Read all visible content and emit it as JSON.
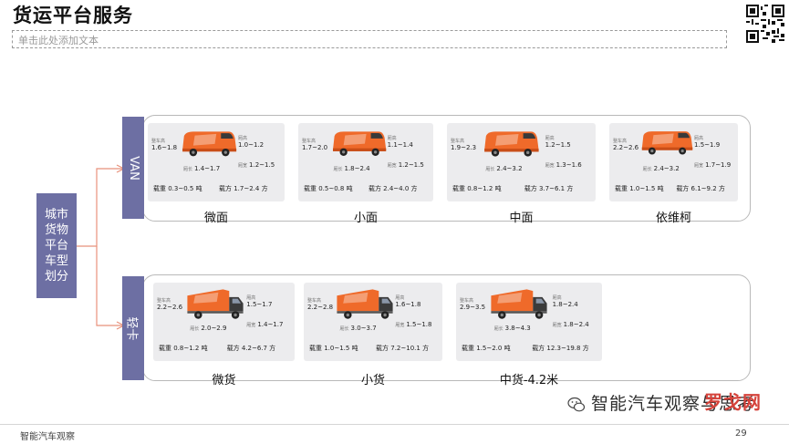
{
  "header": {
    "title": "货运平台服务",
    "subtitle_placeholder": "单击此处添加文本"
  },
  "diagram": {
    "root_label": "城市\n货物\n平台\n车型\n划分",
    "groups": [
      {
        "label": "VAN",
        "cards": [
          {
            "name": "微面",
            "height_label": "整车高",
            "height": "1.6~1.8",
            "width_label": "厢高",
            "width": "1.0~1.2",
            "length_label": "厢长",
            "length": "1.4~1.7",
            "box_width_label": "厢宽",
            "box_width": "1.2~1.5",
            "load": "载重 0.3~0.5 吨",
            "volume": "载方 1.7~2.4 方"
          },
          {
            "name": "小面",
            "height_label": "整车高",
            "height": "1.7~2.0",
            "width_label": "厢高",
            "width": "1.1~1.4",
            "length_label": "厢长",
            "length": "1.8~2.4",
            "box_width_label": "厢宽",
            "box_width": "1.2~1.5",
            "load": "载重 0.5~0.8 吨",
            "volume": "载方 2.4~4.0 方"
          },
          {
            "name": "中面",
            "height_label": "整车高",
            "height": "1.9~2.3",
            "width_label": "厢高",
            "width": "1.2~1.5",
            "length_label": "厢长",
            "length": "2.4~3.2",
            "box_width_label": "厢宽",
            "box_width": "1.3~1.6",
            "load": "载重 0.8~1.2 吨",
            "volume": "载方 3.7~6.1 方"
          },
          {
            "name": "依维柯",
            "height_label": "整车高",
            "height": "2.2~2.6",
            "width_label": "厢高",
            "width": "1.5~1.9",
            "length_label": "厢长",
            "length": "2.4~3.2",
            "box_width_label": "厢宽",
            "box_width": "1.7~1.9",
            "load": "载重 1.0~1.5 吨",
            "volume": "载方 6.1~9.2 方"
          }
        ]
      },
      {
        "label": "轻卡",
        "cards": [
          {
            "name": "微货",
            "height_label": "整车高",
            "height": "2.2~2.6",
            "width_label": "厢高",
            "width": "1.5~1.7",
            "length_label": "厢长",
            "length": "2.0~2.9",
            "box_width_label": "厢宽",
            "box_width": "1.4~1.7",
            "load": "载重 0.8~1.2 吨",
            "volume": "载方 4.2~6.7 方"
          },
          {
            "name": "小货",
            "height_label": "整车高",
            "height": "2.2~2.8",
            "width_label": "厢高",
            "width": "1.6~1.8",
            "length_label": "厢长",
            "length": "3.0~3.7",
            "box_width_label": "厢宽",
            "box_width": "1.5~1.8",
            "load": "载重 1.0~1.5 吨",
            "volume": "载方 7.2~10.1 方"
          },
          {
            "name": "中货-4.2米",
            "height_label": "整车高",
            "height": "2.9~3.5",
            "width_label": "厢高",
            "width": "1.8~2.4",
            "length_label": "厢长",
            "length": "3.8~4.3",
            "box_width_label": "厢宽",
            "box_width": "1.8~2.4",
            "load": "载重 1.5~2.0 吨",
            "volume": "载方 12.3~19.8 方"
          }
        ]
      }
    ]
  },
  "footer": {
    "source": "智能汽车观察",
    "page": "29",
    "watermark": "智能汽车观察与思考",
    "brand": "罗戈网"
  },
  "colors": {
    "label_bg": "#6d6fa3",
    "connector": "#e8917b",
    "vehicle_orange": "#ef6a2a",
    "brand_red": "#d5433b"
  }
}
